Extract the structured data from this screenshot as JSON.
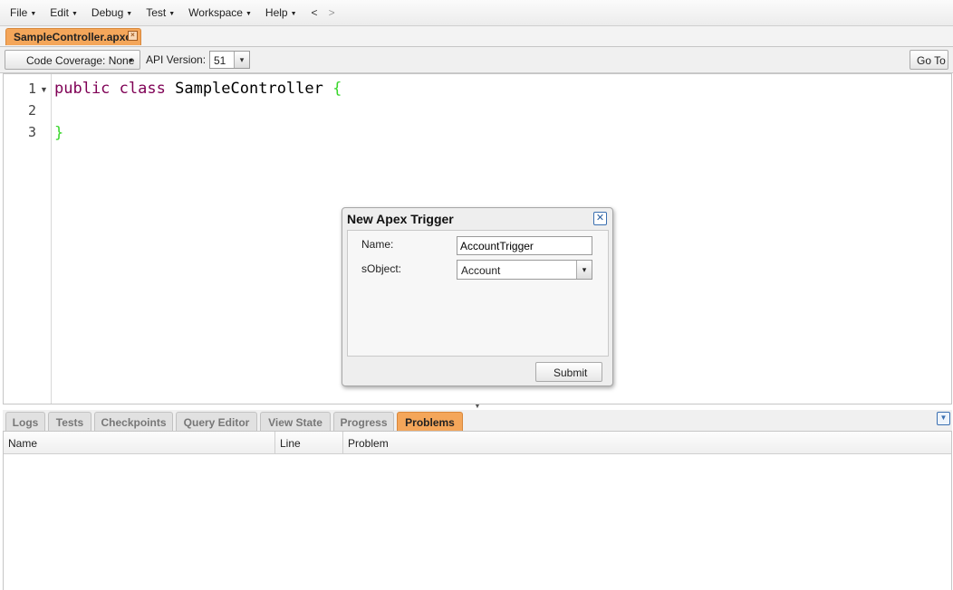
{
  "menu": [
    {
      "label": "File"
    },
    {
      "label": "Edit"
    },
    {
      "label": "Debug"
    },
    {
      "label": "Test"
    },
    {
      "label": "Workspace"
    },
    {
      "label": "Help"
    }
  ],
  "nav": {
    "back": "<",
    "forward": ">"
  },
  "file_tab": {
    "label": "SampleController.apxc",
    "close": "×"
  },
  "toolbar": {
    "coverage_label": "Code Coverage: None",
    "api_label": "API Version:",
    "api_value": "51",
    "goto_label": "Go To"
  },
  "editor": {
    "line_numbers": [
      "1",
      "2",
      "3"
    ],
    "line1": {
      "kw1": "public",
      "kw2": "class",
      "name": "SampleController",
      "brace": "{"
    },
    "line3": {
      "brace": "}"
    }
  },
  "dialog": {
    "title": "New Apex Trigger",
    "name_label": "Name:",
    "name_value": "AccountTrigger",
    "sobject_label": "sObject:",
    "sobject_value": "Account",
    "submit_label": "Submit"
  },
  "bottom_tabs": [
    {
      "label": "Logs"
    },
    {
      "label": "Tests"
    },
    {
      "label": "Checkpoints"
    },
    {
      "label": "Query Editor"
    },
    {
      "label": "View State"
    },
    {
      "label": "Progress"
    },
    {
      "label": "Problems",
      "active": true
    }
  ],
  "problems_table": {
    "columns": [
      "Name",
      "Line",
      "Problem"
    ]
  },
  "colors": {
    "active_tab": "#f4a65a",
    "keyword": "#7f0055",
    "brace": "#38d62a"
  }
}
